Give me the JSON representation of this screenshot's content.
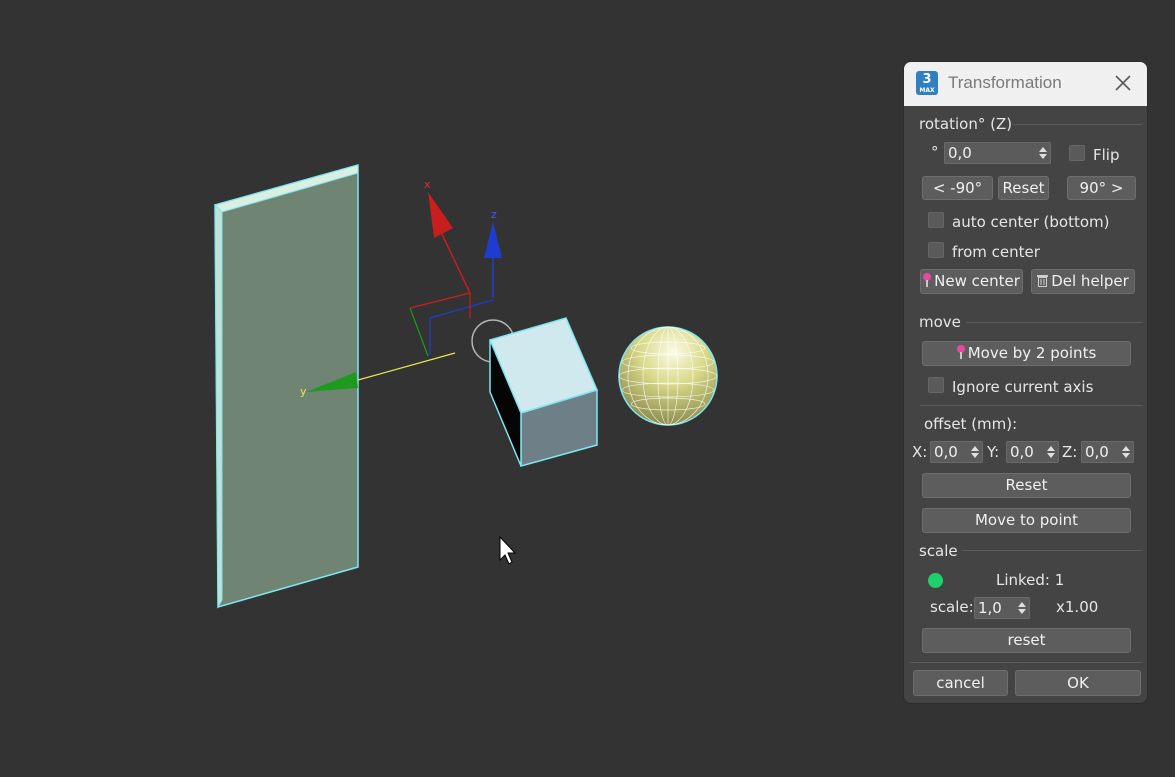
{
  "viewport": {
    "axis_labels": {
      "x": "x",
      "y": "y",
      "z": "z"
    }
  },
  "dialog": {
    "title": "Transformation",
    "app_icon": {
      "number": "3",
      "sub": "MAX"
    },
    "close_icon": "close-icon",
    "rotation": {
      "section_label": "rotation° (Z)",
      "degree_symbol": "°",
      "angle_value": "0,0",
      "flip_label": "Flip",
      "minus90_label": "< -90°",
      "reset_label": "Reset",
      "plus90_label": "90° >",
      "auto_center_label": "auto center (bottom)",
      "from_center_label": "from  center",
      "new_center_label": "New center",
      "del_helper_label": "Del helper"
    },
    "move": {
      "section_label": "move",
      "move_by_2_points_label": "Move by 2 points",
      "ignore_axis_label": "Ignore current axis",
      "offset_label": "offset (mm):",
      "x_label": "X:",
      "x_value": "0,0",
      "y_label": "Y:",
      "y_value": "0,0",
      "z_label": "Z:",
      "z_value": "0,0",
      "reset_label": "Reset",
      "move_to_point_label": "Move to point"
    },
    "scale": {
      "section_label": "scale",
      "linked_label": "Linked: 1",
      "scale_label": "scale:",
      "scale_value": "1,0",
      "multiplier": "x1.00",
      "reset_label": "reset"
    },
    "footer": {
      "cancel_label": "cancel",
      "ok_label": "OK"
    }
  },
  "colors": {
    "viewport_bg": "#333333",
    "dialog_bg": "#444444",
    "selection_outline": "#7fe6f0",
    "x_axis": "#c81e1e",
    "y_axis": "#1e9a1e",
    "z_axis": "#1e3ccf",
    "accent_green": "#1fcf6a",
    "pin_color": "#e64aa0"
  }
}
